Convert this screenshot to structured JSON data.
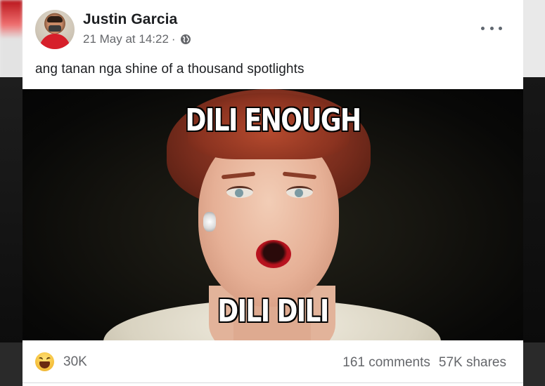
{
  "post": {
    "author": "Justin Garcia",
    "timestamp": "21 May at 14:22",
    "separator": "·",
    "privacy_icon": "globe-icon",
    "more_icon": "more-options-icon",
    "caption": "ang tanan nga shine of a thousand spotlights"
  },
  "meme": {
    "top_text": "DILI ENOUGH",
    "bottom_text": "DILI DILI"
  },
  "engagement": {
    "reaction_icon": "haha-reaction-icon",
    "reaction_count": "30K",
    "comments": "161 comments",
    "shares": "57K shares"
  },
  "colors": {
    "card_bg": "#ffffff",
    "text_primary": "#1c1e21",
    "text_secondary": "#65676b",
    "meme_text": "#ffffff"
  }
}
